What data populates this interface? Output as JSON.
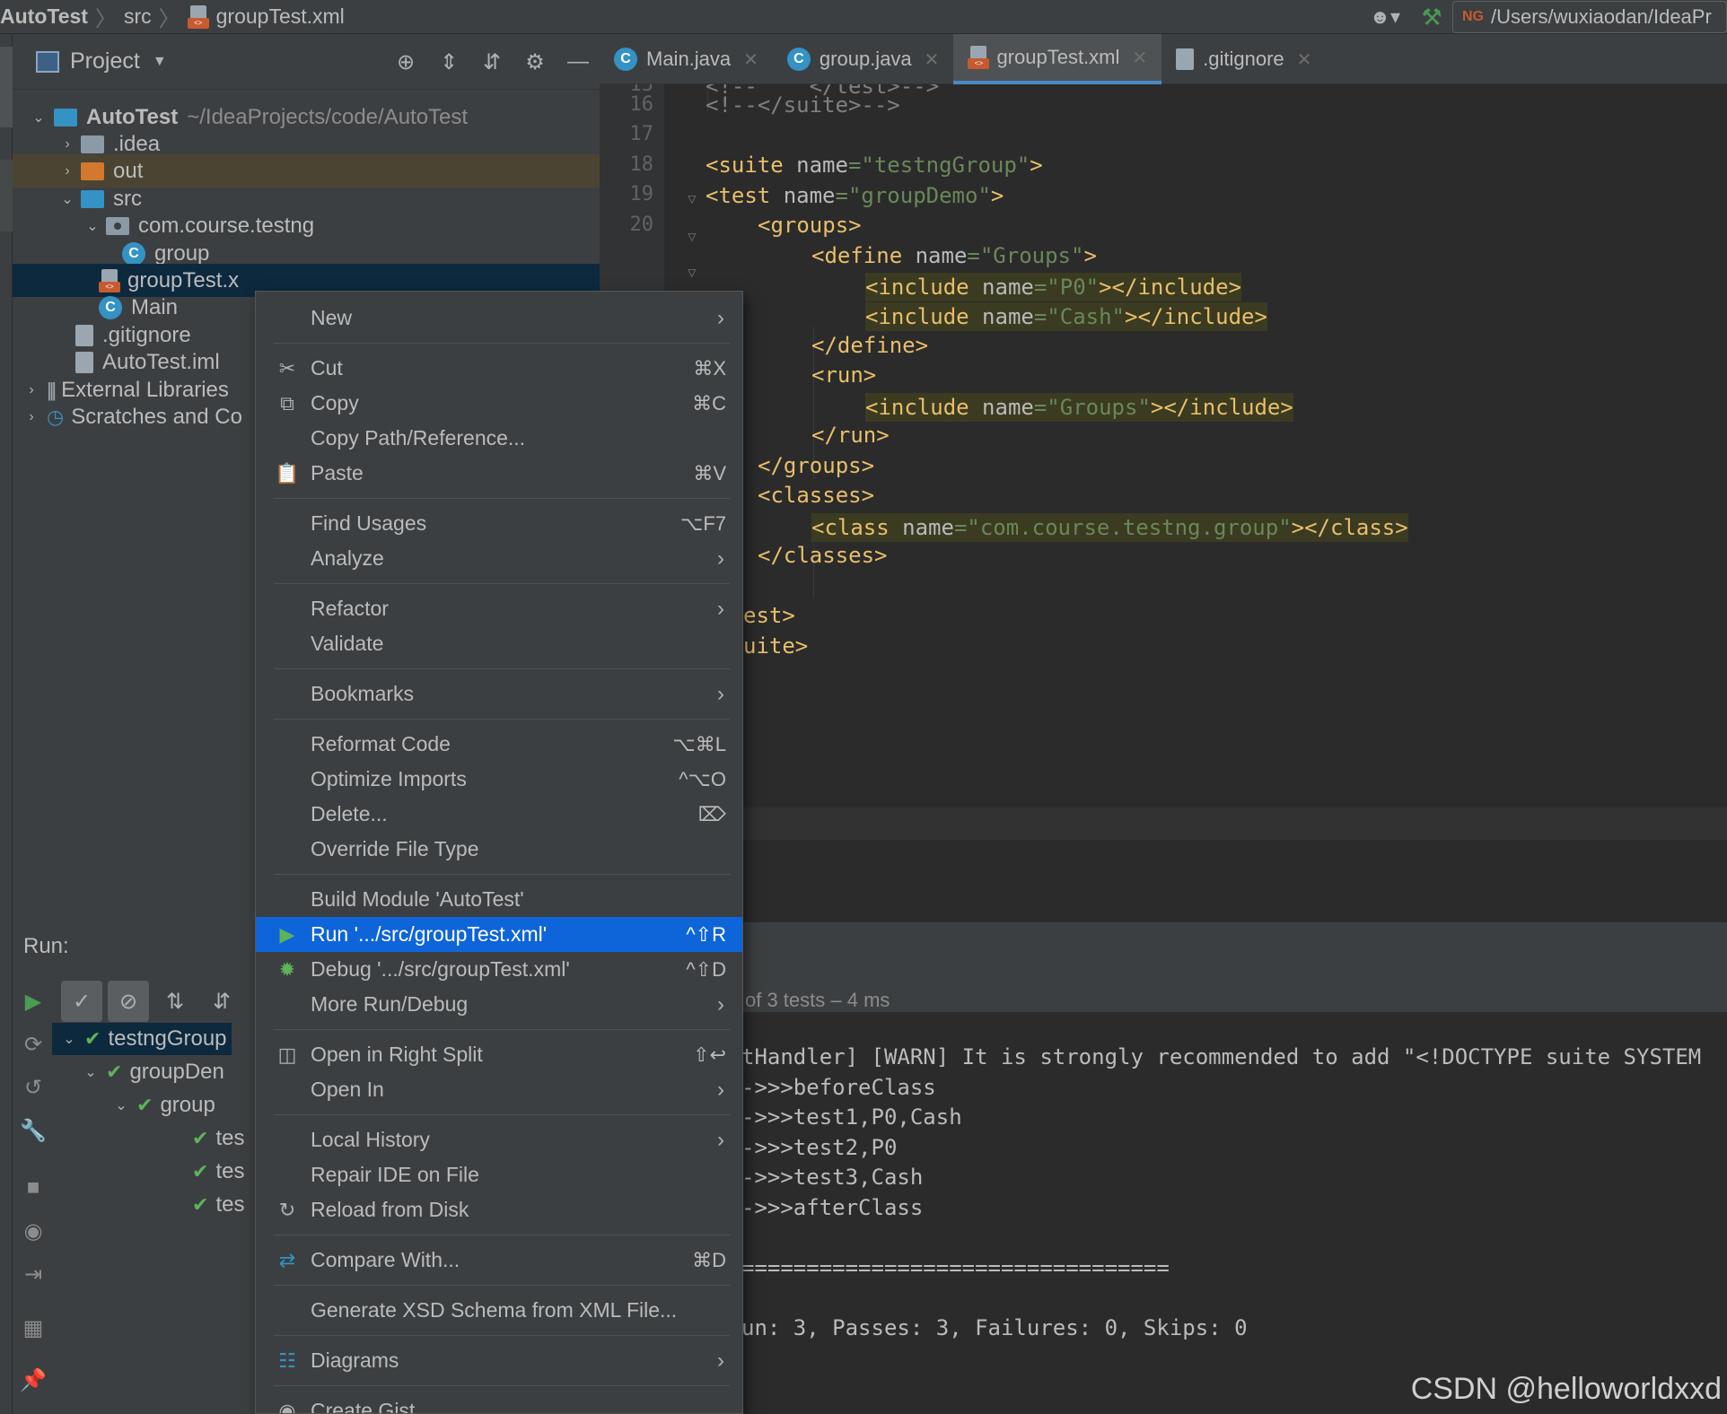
{
  "navbar": {
    "project": "AutoTest",
    "folder": "src",
    "file": "groupTest.xml",
    "run_config_prefix": "NG",
    "run_config_path": "/Users/wuxiaodan/IdeaPr"
  },
  "project_panel": {
    "title": "Project",
    "tree": {
      "root": "AutoTest",
      "root_path": "~/IdeaProjects/code/AutoTest",
      "idea": ".idea",
      "out": "out",
      "src": "src",
      "package": "com.course.testng",
      "group": "group",
      "groupTest": "groupTest.x",
      "main": "Main",
      "gitignore": ".gitignore",
      "iml": "AutoTest.iml",
      "external": "External Libraries",
      "scratches": "Scratches and Co"
    }
  },
  "editor": {
    "tabs": [
      {
        "label": "Main.java"
      },
      {
        "label": "group.java"
      },
      {
        "label": "groupTest.xml"
      },
      {
        "label": ".gitignore"
      }
    ],
    "line_numbers": [
      "15",
      "16",
      "17",
      "18",
      "19",
      "20"
    ],
    "code": {
      "l15": "<!--    </test>-->",
      "l16": "<!--</suite>-->",
      "suite_open": "<suite ",
      "suite_attr": "name",
      "suite_val": "\"testngGroup\"",
      "test_open": "<test ",
      "test_attr": "name",
      "test_val": "\"groupDemo\"",
      "groups_open": "<groups>",
      "define_open": "<define ",
      "define_attr": "name",
      "define_val": "\"Groups\"",
      "inc_open": "<include ",
      "inc_attr": "name",
      "inc_p0": "\"P0\"",
      "inc_cash": "\"Cash\"",
      "inc_groups": "\"Groups\"",
      "inc_close": "></include>",
      "define_close": "</define>",
      "run_open": "<run>",
      "run_close": "</run>",
      "groups_close": "</groups>",
      "classes_open": "<classes>",
      "class_open": "<class ",
      "class_attr": "name",
      "class_val": "\"com.course.testng.group\"",
      "class_close": "></class>",
      "classes_close": "</classes>",
      "test_close": "est>",
      "suite_close": "uite>",
      "gt": ">",
      "eq": "="
    }
  },
  "run_panel": {
    "label": "Run:",
    "status": "of 3 tests – 4 ms",
    "tree": [
      "testngGroup",
      "groupDen",
      "group",
      "tes",
      "tes",
      "tes"
    ],
    "console": [
      "tHandler] [WARN] It is strongly recommended to add \"<!DOCTYPE suite SYSTEM",
      "->>>beforeClass",
      "->>>test1,P0,Cash",
      "->>>test2,P0",
      "->>>test3,Cash",
      "->>>afterClass",
      "=================================",
      "un: 3, Passes: 3, Failures: 0, Skips: 0"
    ]
  },
  "context_menu": {
    "new": "New",
    "cut": "Cut",
    "cut_sc": "⌘X",
    "copy": "Copy",
    "copy_sc": "⌘C",
    "copy_path": "Copy Path/Reference...",
    "paste": "Paste",
    "paste_sc": "⌘V",
    "find_usages": "Find Usages",
    "find_usages_sc": "⌥F7",
    "analyze": "Analyze",
    "refactor": "Refactor",
    "validate": "Validate",
    "bookmarks": "Bookmarks",
    "reformat": "Reformat Code",
    "reformat_sc": "⌥⌘L",
    "optimize": "Optimize Imports",
    "optimize_sc": "^⌥O",
    "delete": "Delete...",
    "delete_sc": "⌦",
    "override": "Override File Type",
    "build": "Build Module 'AutoTest'",
    "run": "Run '.../src/groupTest.xml'",
    "run_sc": "^⇧R",
    "debug": "Debug '.../src/groupTest.xml'",
    "debug_sc": "^⇧D",
    "more_run": "More Run/Debug",
    "open_split": "Open in Right Split",
    "open_split_sc": "⇧↩",
    "open_in": "Open In",
    "local_history": "Local History",
    "repair": "Repair IDE on File",
    "reload": "Reload from Disk",
    "compare": "Compare With...",
    "compare_sc": "⌘D",
    "xsd": "Generate XSD Schema from XML File...",
    "diagrams": "Diagrams",
    "gist": "Create Gist..."
  },
  "watermark": "CSDN @helloworldxxd"
}
